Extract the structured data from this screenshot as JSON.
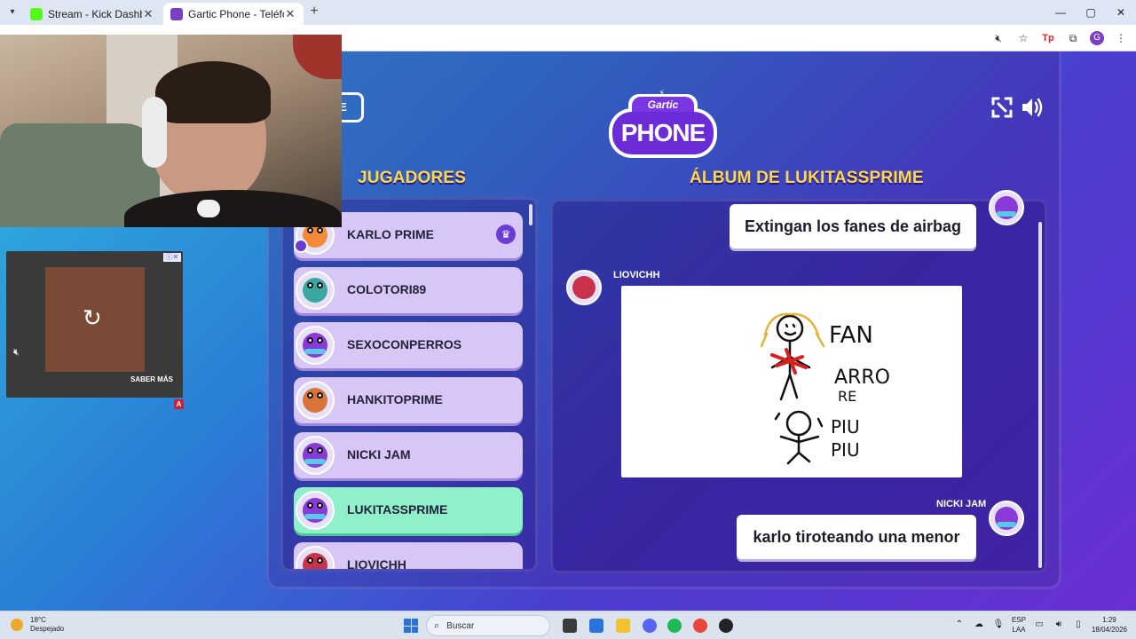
{
  "browser": {
    "tabs": [
      {
        "title": "Stream - Kick Dashboard",
        "fav_color": "#53fc18"
      },
      {
        "title": "Gartic Phone - Teléfono Descon",
        "fav_color": "#7b3fc4"
      }
    ],
    "window_controls": [
      "—",
      "▢",
      "✕"
    ]
  },
  "game": {
    "logo_line1": "Gartic",
    "logo_line2": "PHONE",
    "stub_button_label": "E",
    "players_title": "JUGADORES",
    "album_title": "ÁLBUM DE LUKITASSPRIME",
    "players": [
      {
        "name": "KARLO PRIME",
        "color": "#f28a3a",
        "host": true
      },
      {
        "name": "COLOTORI89",
        "color": "#3aa8a0"
      },
      {
        "name": "SEXOCONPERROS",
        "color": "#8a3ad6"
      },
      {
        "name": "HANKITOPRIME",
        "color": "#d8743a"
      },
      {
        "name": "NICKI JAM",
        "color": "#8a3ad6"
      },
      {
        "name": "LUKITASSPRIME",
        "color": "#8a3ad6",
        "current": true
      },
      {
        "name": "LIOVICHH",
        "color": "#c8324a"
      }
    ],
    "album": {
      "entry1_text": "Extingan los fanes de airbag",
      "entry2_author": "LIOVICHH",
      "entry3_author": "NICKI JAM",
      "entry3_text": "karlo tiroteando una menor",
      "drawing_text": [
        "FAN",
        "ARRO",
        "RE",
        "PIU",
        "PIU"
      ]
    }
  },
  "ad": {
    "cta": "SABER MÁS",
    "badge": "A"
  },
  "taskbar": {
    "temperature": "18°C",
    "weather": "Despejado",
    "search_placeholder": "Buscar",
    "lang_top": "ESP",
    "lang_bottom": "LAA",
    "time": "1:29",
    "date": "18/04/2026"
  }
}
